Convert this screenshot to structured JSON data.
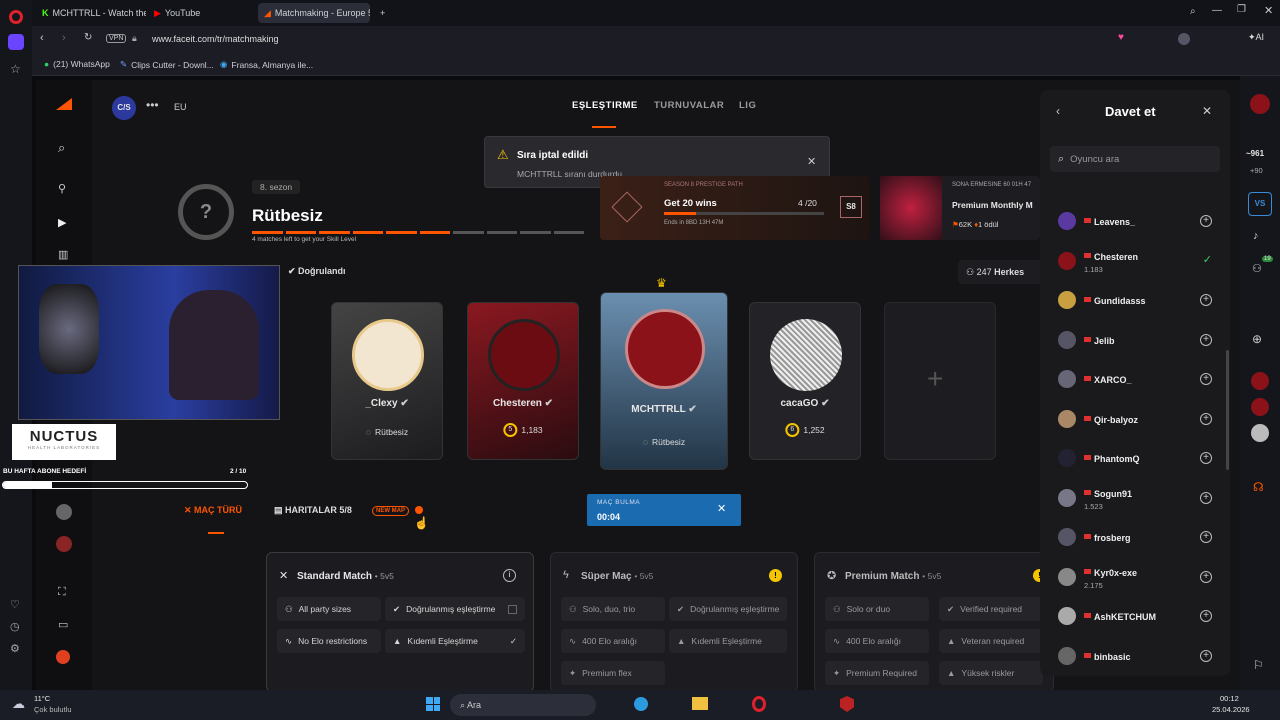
{
  "browser": {
    "tabs": [
      {
        "label": "MCHTTRLL - Watch the VO",
        "icon": "kick-icon"
      },
      {
        "label": "YouTube",
        "icon": "youtube-icon"
      },
      {
        "label": "Matchmaking - Europe 5v",
        "icon": "faceit-icon"
      }
    ],
    "url": "www.faceit.com/tr/matchmaking",
    "vpn": "VPN",
    "bookmarks": [
      "(21) WhatsApp",
      "Clips Cutter - Downl...",
      "Fransa, Almanya ile..."
    ],
    "ai_label": "AI"
  },
  "faceit": {
    "party_tag": "C/S",
    "region": "EU",
    "nav": [
      "EŞLEŞTIRME",
      "TURNUVALAR",
      "LIG"
    ],
    "toast": {
      "title": "Sıra iptal edildi",
      "message": "MCHTTRLL sıranı durdurdu"
    },
    "season": "8. sezon",
    "rank": "Rütbesiz",
    "matches_left": "4 matches left to get your Skill Level",
    "verified": "Doğrulandı",
    "season_pass": {
      "title": "Get 20 wins",
      "progress": "4 /20",
      "ends": "Ends in 8BD 13H 47M",
      "level": "S8",
      "header": "SEASON 8 PRESTIGE PATH"
    },
    "premium": {
      "header": "SONA ERMESINE 60 01H 47",
      "title": "Premium Monthly M",
      "stats": "62K",
      "award": "1 ödül"
    },
    "online": "247",
    "online_label": "Herkes",
    "players": [
      {
        "name": "_Clexy",
        "rank": "Rütbesiz",
        "level": "",
        "elo": ""
      },
      {
        "name": "Chesteren",
        "rank": "",
        "level": "5",
        "elo": "1,183"
      },
      {
        "name": "MCHTTRLL",
        "rank": "Rütbesiz",
        "level": "",
        "elo": ""
      },
      {
        "name": "cacaGO",
        "rank": "",
        "level": "6",
        "elo": "1,252"
      }
    ],
    "tabs": {
      "mode": "MAÇ TÜRÜ",
      "maps": "HARITALAR 5/8",
      "new_map": "NEW MAP"
    },
    "queue": {
      "label": "MAÇ BULMA",
      "time": "00:04"
    },
    "modes": [
      {
        "title": "Standard Match",
        "size": "• 5v5",
        "chips": [
          "All party sizes",
          "Doğrulanmış eşleştirme",
          "No Elo restrictions",
          "Kıdemli Eşleştirme"
        ]
      },
      {
        "title": "Süper Maç",
        "size": "• 5v5",
        "chips": [
          "Solo, duo, trio",
          "Doğrulanmış eşleştirme",
          "400 Elo aralığı",
          "Kıdemli Eşleştirme",
          "Premium flex"
        ]
      },
      {
        "title": "Premium Match",
        "size": "• 5v5",
        "chips": [
          "Solo or duo",
          "Verified required",
          "400 Elo aralığı",
          "Veteran required",
          "Premium Required",
          "Yüksek riskler"
        ]
      }
    ]
  },
  "invite": {
    "title": "Davet et",
    "search_placeholder": "Oyuncu ara",
    "friends": [
      {
        "name": "Leavens_",
        "sub": ""
      },
      {
        "name": "Chesteren",
        "sub": "1.183"
      },
      {
        "name": "Gundidasss",
        "sub": ""
      },
      {
        "name": "Jelib",
        "sub": ""
      },
      {
        "name": "XARCO_",
        "sub": ""
      },
      {
        "name": "Qir-balyoz",
        "sub": ""
      },
      {
        "name": "PhantomQ",
        "sub": ""
      },
      {
        "name": "Sogun91",
        "sub": "1.523"
      },
      {
        "name": "frosberg",
        "sub": ""
      },
      {
        "name": "Kyr0x-exe",
        "sub": "2.175"
      },
      {
        "name": "AshKETCHUM",
        "sub": ""
      },
      {
        "name": "binbasic",
        "sub": ""
      }
    ]
  },
  "right_rail": {
    "elo": "~961",
    "delta": "+90",
    "badge": "19"
  },
  "overlay": {
    "brand": "NUCTUS",
    "brand_sub": "HEALTH LABORATORIES",
    "goal_label": "BU HAFTA ABONE HEDEFİ",
    "goal_value": "2 / 10",
    "goal_fraction": 0.2
  },
  "taskbar": {
    "temp": "11°C",
    "weather": "Çok bulutlu",
    "search": "Ara",
    "time": "00:12",
    "date": "25.04.2026"
  }
}
